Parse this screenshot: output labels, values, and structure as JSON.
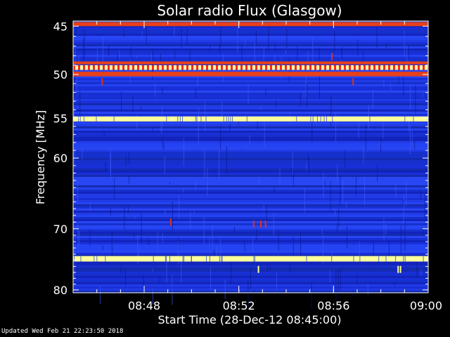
{
  "chart_data": {
    "type": "heatmap",
    "title": "Solar radio Flux (Glasgow)",
    "xlabel": "Start Time (28-Dec-12 08:45:00)",
    "ylabel": "Frequency [MHz]",
    "x_ticks": [
      {
        "label": "08:48",
        "minutes": 3
      },
      {
        "label": "08:52",
        "minutes": 7
      },
      {
        "label": "08:56",
        "minutes": 11
      },
      {
        "label": "09:00",
        "minutes": 15
      }
    ],
    "xlim_minutes": [
      0,
      15
    ],
    "y_ticks": [
      45,
      50,
      55,
      60,
      70,
      80
    ],
    "ylim_mhz": [
      44.5,
      80.5
    ],
    "y_scale": "log",
    "bands": [
      {
        "freq_mhz": [
          44.6,
          45.0
        ],
        "level": "orange"
      },
      {
        "freq_mhz": [
          48.6,
          48.9
        ],
        "level": "orange"
      },
      {
        "freq_mhz": [
          49.0,
          49.5
        ],
        "level": "yellow-red-dashed"
      },
      {
        "freq_mhz": [
          49.7,
          50.2
        ],
        "level": "orange"
      },
      {
        "freq_mhz": [
          54.8,
          55.4
        ],
        "level": "yellow"
      },
      {
        "freq_mhz": [
          74.3,
          75.2
        ],
        "level": "yellow"
      }
    ],
    "background_level": "blue",
    "colors": {
      "background": "#000000",
      "low": "#1a2fd8",
      "mid": "#3a5cff",
      "high": "#d81a10",
      "max": "#ffffa0"
    }
  },
  "footer": "Updated Wed Feb 21 22:23:50 2018"
}
